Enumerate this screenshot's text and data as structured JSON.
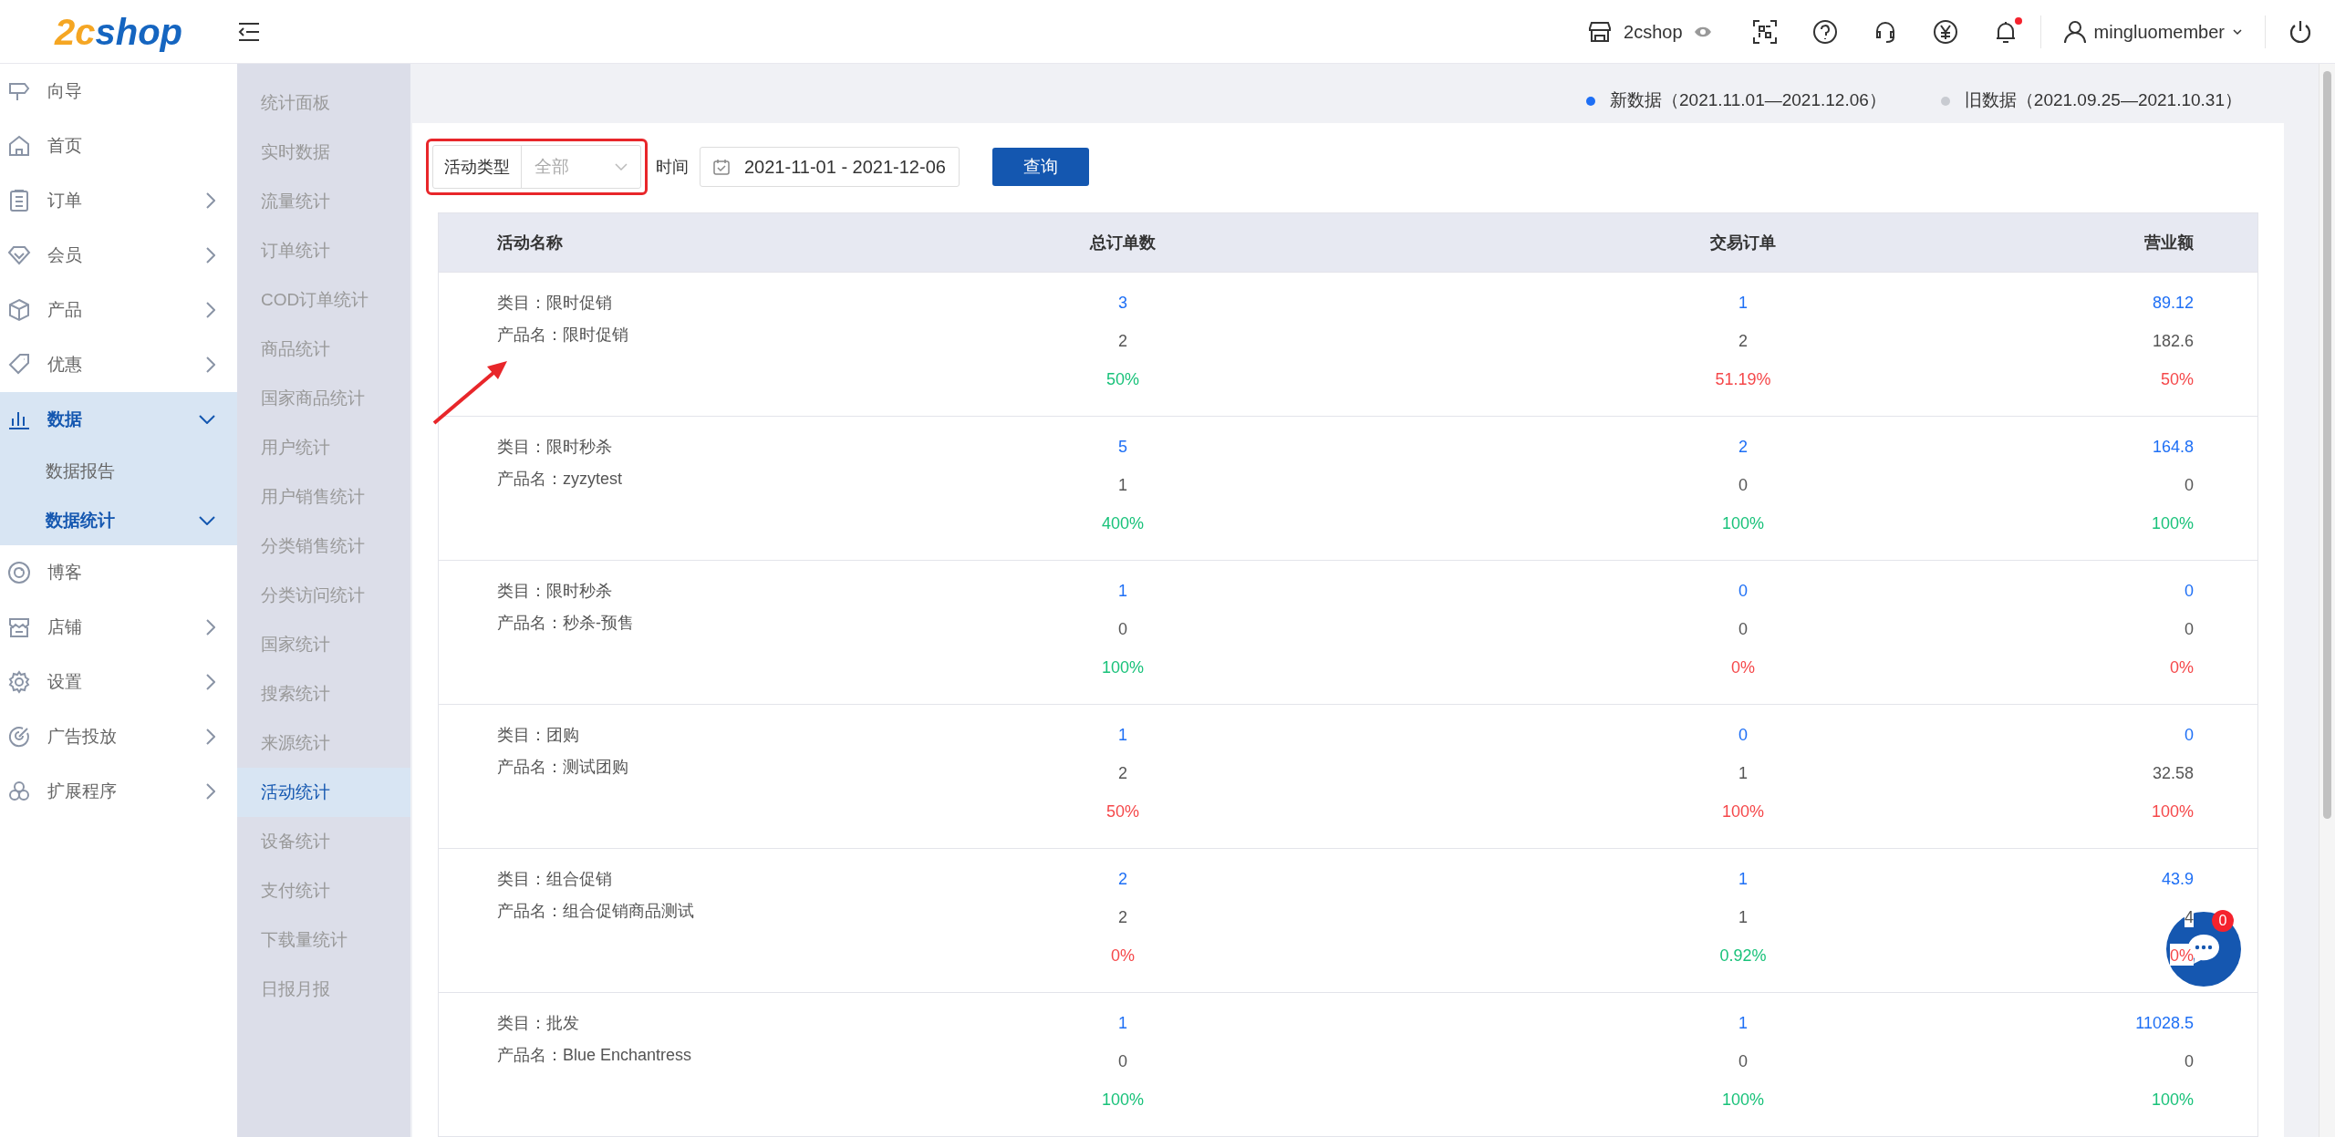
{
  "header": {
    "logo_mark": "2c",
    "logo_text": "shop",
    "store": "2cshop",
    "user": "mingluomember",
    "has_unread": true
  },
  "menu": [
    {
      "label": "向导",
      "kind": "signpost",
      "has_children": false,
      "selected": false
    },
    {
      "label": "首页",
      "kind": "home",
      "has_children": false,
      "selected": false
    },
    {
      "label": "订单",
      "kind": "clipboard",
      "has_children": true,
      "expanded": false,
      "selected": false
    },
    {
      "label": "会员",
      "kind": "diamond",
      "has_children": true,
      "expanded": false,
      "selected": false
    },
    {
      "label": "产品",
      "kind": "cube",
      "has_children": true,
      "expanded": false,
      "selected": false
    },
    {
      "label": "优惠",
      "kind": "tag",
      "has_children": true,
      "expanded": false,
      "selected": false
    },
    {
      "label": "数据",
      "kind": "bars",
      "has_children": true,
      "expanded": true,
      "selected": true,
      "children": [
        {
          "label": "数据报告",
          "has_children": false,
          "selected": false
        },
        {
          "label": "数据统计",
          "has_children": true,
          "selected": true
        }
      ]
    },
    {
      "label": "博客",
      "kind": "spiral",
      "has_children": false,
      "selected": false
    },
    {
      "label": "店铺",
      "kind": "store",
      "has_children": true,
      "expanded": false,
      "selected": false
    },
    {
      "label": "设置",
      "kind": "gear",
      "has_children": true,
      "expanded": false,
      "selected": false
    },
    {
      "label": "广告投放",
      "kind": "target",
      "has_children": true,
      "expanded": false,
      "selected": false
    },
    {
      "label": "扩展程序",
      "kind": "circles",
      "has_children": true,
      "expanded": false,
      "selected": false
    }
  ],
  "submenu": [
    {
      "label": "统计面板",
      "selected": false
    },
    {
      "label": "实时数据",
      "selected": false
    },
    {
      "label": "流量统计",
      "selected": false
    },
    {
      "label": "订单统计",
      "selected": false
    },
    {
      "label": "COD订单统计",
      "selected": false
    },
    {
      "label": "商品统计",
      "selected": false
    },
    {
      "label": "国家商品统计",
      "selected": false
    },
    {
      "label": "用户统计",
      "selected": false
    },
    {
      "label": "用户销售统计",
      "selected": false
    },
    {
      "label": "分类销售统计",
      "selected": false
    },
    {
      "label": "分类访问统计",
      "selected": false
    },
    {
      "label": "国家统计",
      "selected": false
    },
    {
      "label": "搜索统计",
      "selected": false
    },
    {
      "label": "来源统计",
      "selected": false
    },
    {
      "label": "活动统计",
      "selected": true
    },
    {
      "label": "设备统计",
      "selected": false
    },
    {
      "label": "支付统计",
      "selected": false
    },
    {
      "label": "下载量统计",
      "selected": false
    },
    {
      "label": "日报月报",
      "selected": false
    }
  ],
  "legend": [
    {
      "label": "新数据（2021.11.01—2021.12.06）",
      "color": "#1e6ff5"
    },
    {
      "label": "旧数据（2021.09.25—2021.10.31）",
      "color": "#c8cbd1"
    }
  ],
  "filter": {
    "label": "活动类型",
    "placeholder": "全部",
    "time_label": "时间",
    "date_range": "2021-11-01 - 2021-12-06",
    "button": "查询"
  },
  "table": {
    "columns": [
      "活动名称",
      "总订单数",
      "交易订单",
      "营业额"
    ],
    "rows": [
      {
        "cells": [
          {
            "category": "类目：限时促销",
            "product": "产品名：限时促销"
          },
          {
            "new": "3",
            "old": "2",
            "change": "50%",
            "color": "#19c27a"
          },
          {
            "new": "1",
            "old": "2",
            "change": "51.19%",
            "color": "#f5484a"
          },
          {
            "new": "89.12",
            "old": "182.6",
            "change": "50%",
            "color": "#f5484a"
          }
        ]
      },
      {
        "cells": [
          {
            "category": "类目：限时秒杀",
            "product": "产品名：zyzytest"
          },
          {
            "new": "5",
            "old": "1",
            "change": "400%",
            "color": "#19c27a"
          },
          {
            "new": "2",
            "old": "0",
            "change": "100%",
            "color": "#19c27a"
          },
          {
            "new": "164.8",
            "old": "0",
            "change": "100%",
            "color": "#19c27a"
          }
        ]
      },
      {
        "cells": [
          {
            "category": "类目：限时秒杀",
            "product": "产品名：秒杀-预售"
          },
          {
            "new": "1",
            "old": "0",
            "change": "100%",
            "color": "#19c27a"
          },
          {
            "new": "0",
            "old": "0",
            "change": "0%",
            "color": "#f5484a"
          },
          {
            "new": "0",
            "old": "0",
            "change": "0%",
            "color": "#f5484a"
          }
        ]
      },
      {
        "cells": [
          {
            "category": "类目：团购",
            "product": "产品名：测试团购"
          },
          {
            "new": "1",
            "old": "2",
            "change": "50%",
            "color": "#f5484a"
          },
          {
            "new": "0",
            "old": "1",
            "change": "100%",
            "color": "#f5484a"
          },
          {
            "new": "0",
            "old": "32.58",
            "change": "100%",
            "color": "#f5484a"
          }
        ]
      },
      {
        "cells": [
          {
            "category": "类目：组合促销",
            "product": "产品名：组合促销商品测试"
          },
          {
            "new": "2",
            "old": "2",
            "change": "0%",
            "color": "#f5484a"
          },
          {
            "new": "1",
            "old": "1",
            "change": "0.92%",
            "color": "#19c27a"
          },
          {
            "new": "43.9",
            "old": "4",
            "change": "0%",
            "color": "#f5484a"
          }
        ]
      },
      {
        "cells": [
          {
            "category": "类目：批发",
            "product": "产品名：Blue Enchantress"
          },
          {
            "new": "1",
            "old": "0",
            "change": "100%",
            "color": "#19c27a"
          },
          {
            "new": "1",
            "old": "0",
            "change": "100%",
            "color": "#19c27a"
          },
          {
            "new": "11028.5",
            "old": "0",
            "change": "100%",
            "color": "#19c27a"
          }
        ]
      }
    ]
  },
  "chat": {
    "badge": "0"
  },
  "annotations": {
    "filter_box": true,
    "arrow": true
  }
}
